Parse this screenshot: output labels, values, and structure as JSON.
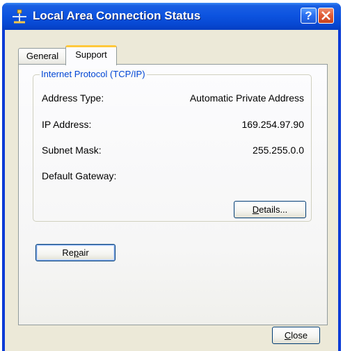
{
  "window": {
    "title": "Local Area Connection Status",
    "icon": "network-connection-icon",
    "help_glyph": "?",
    "close_glyph": "X"
  },
  "tabs": [
    {
      "label": "General",
      "active": false
    },
    {
      "label": "Support",
      "active": true
    }
  ],
  "group": {
    "legend": "Internet Protocol (TCP/IP)",
    "rows": [
      {
        "label": "Address Type:",
        "value": "Automatic Private Address"
      },
      {
        "label": "IP Address:",
        "value": "169.254.97.90"
      },
      {
        "label": "Subnet Mask:",
        "value": "255.255.0.0"
      },
      {
        "label": "Default Gateway:",
        "value": ""
      }
    ]
  },
  "buttons": {
    "details": {
      "mnemonic": "D",
      "rest": "etails..."
    },
    "repair": {
      "before": "Re",
      "mnemonic": "p",
      "after": "air"
    },
    "close": {
      "mnemonic": "C",
      "rest": "lose"
    }
  },
  "colors": {
    "titlebar": "#0d54e0",
    "dialog_face": "#ece9d8",
    "legend_text": "#0046d5",
    "active_tab_accent": "#ffc83c",
    "close_button": "#e05a33"
  }
}
